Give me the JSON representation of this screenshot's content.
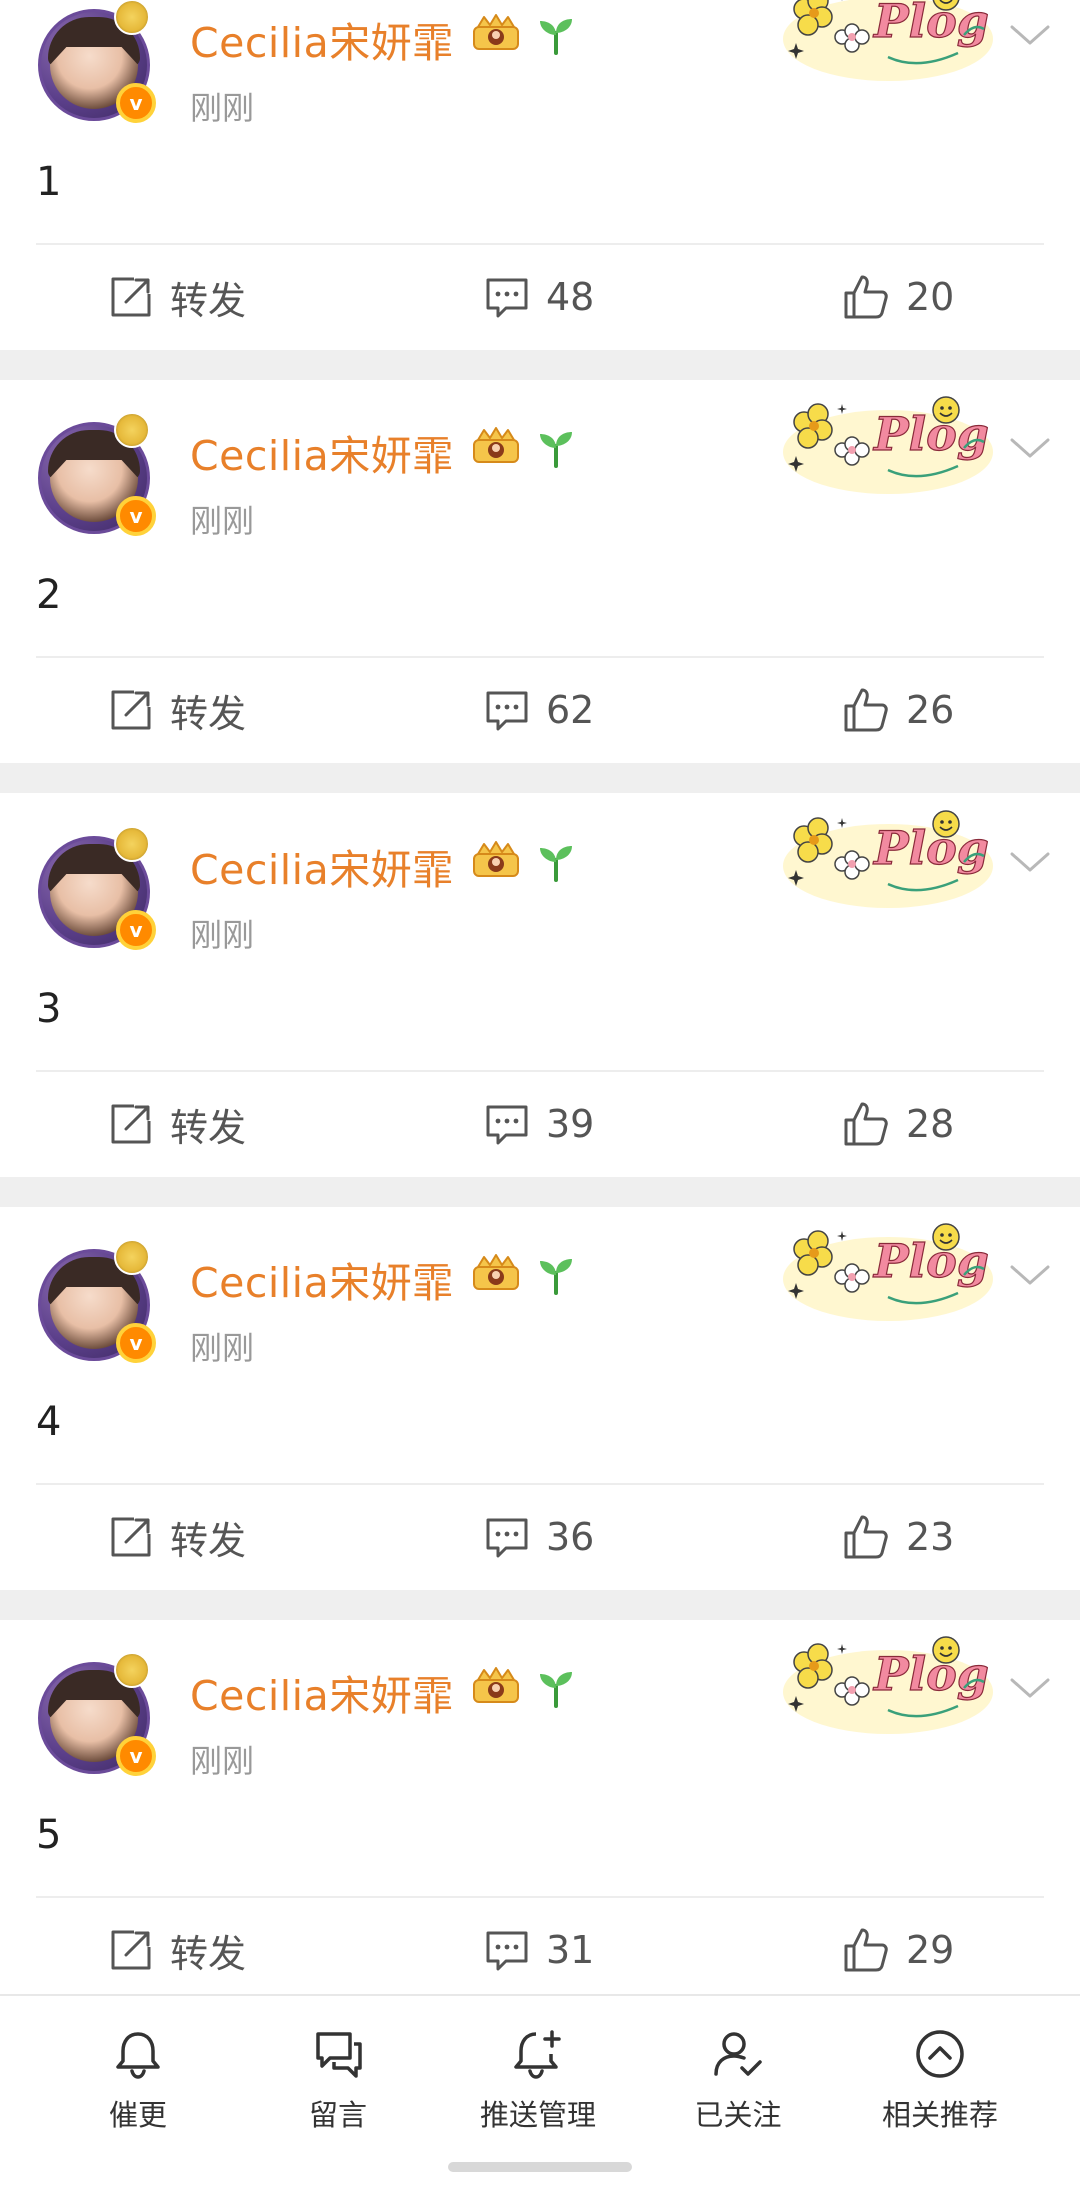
{
  "colors": {
    "username": "#e8802a",
    "verified_badge": "#ff8a00",
    "separator": "#efefef",
    "text_secondary": "#999999"
  },
  "posts": [
    {
      "username": "Cecilia宋妍霏",
      "time": "刚刚",
      "text": "1",
      "repost_label": "转发",
      "comments": "48",
      "likes": "20"
    },
    {
      "username": "Cecilia宋妍霏",
      "time": "刚刚",
      "text": "2",
      "repost_label": "转发",
      "comments": "62",
      "likes": "26"
    },
    {
      "username": "Cecilia宋妍霏",
      "time": "刚刚",
      "text": "3",
      "repost_label": "转发",
      "comments": "39",
      "likes": "28"
    },
    {
      "username": "Cecilia宋妍霏",
      "time": "刚刚",
      "text": "4",
      "repost_label": "转发",
      "comments": "36",
      "likes": "23"
    },
    {
      "username": "Cecilia宋妍霏",
      "time": "刚刚",
      "text": "5",
      "repost_label": "转发",
      "comments": "31",
      "likes": "29"
    }
  ],
  "bottom_bar": {
    "tabs": [
      {
        "label": "催更",
        "icon": "bell-icon"
      },
      {
        "label": "留言",
        "icon": "chat-bubbles-icon"
      },
      {
        "label": "推送管理",
        "icon": "bell-plus-icon"
      },
      {
        "label": "已关注",
        "icon": "user-check-icon"
      },
      {
        "label": "相关推荐",
        "icon": "chevron-up-circle-icon"
      }
    ]
  }
}
